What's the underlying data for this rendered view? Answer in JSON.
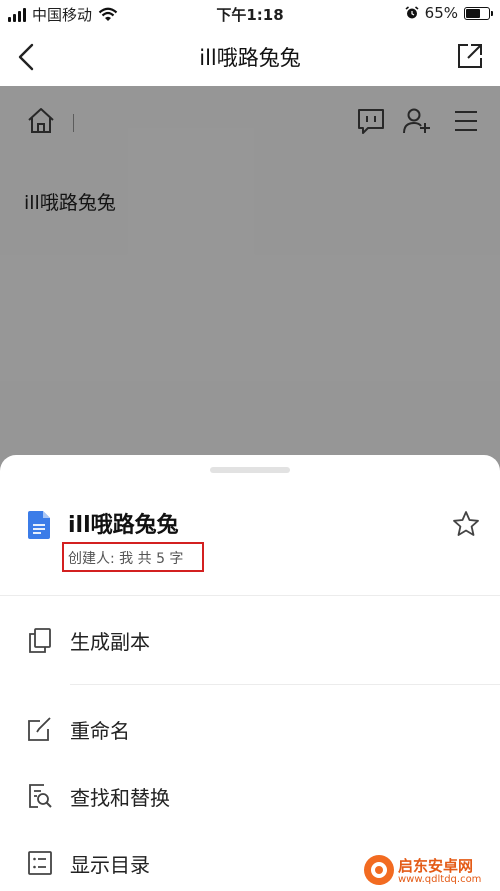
{
  "status_bar": {
    "carrier": "中国移动",
    "time": "下午1:18",
    "battery": "65%",
    "battery_level": 0.65
  },
  "nav": {
    "title": "ill哦路兔兔"
  },
  "document": {
    "body_text": "ill哦路兔兔"
  },
  "sheet": {
    "file_title": "ill哦路兔兔",
    "meta": "创建人: 我 共 5 字",
    "menu": [
      {
        "label": "生成副本",
        "icon": "copy-icon"
      },
      {
        "label": "重命名",
        "icon": "rename-icon"
      },
      {
        "label": "查找和替换",
        "icon": "find-replace-icon"
      },
      {
        "label": "显示目录",
        "icon": "toc-icon"
      }
    ]
  },
  "watermark": {
    "name": "启东安卓网",
    "url": "www.qdltdq.com"
  },
  "colors": {
    "accent_blue": "#3b7ce8",
    "highlight_red": "#d32020",
    "watermark_orange": "#f26b21"
  }
}
